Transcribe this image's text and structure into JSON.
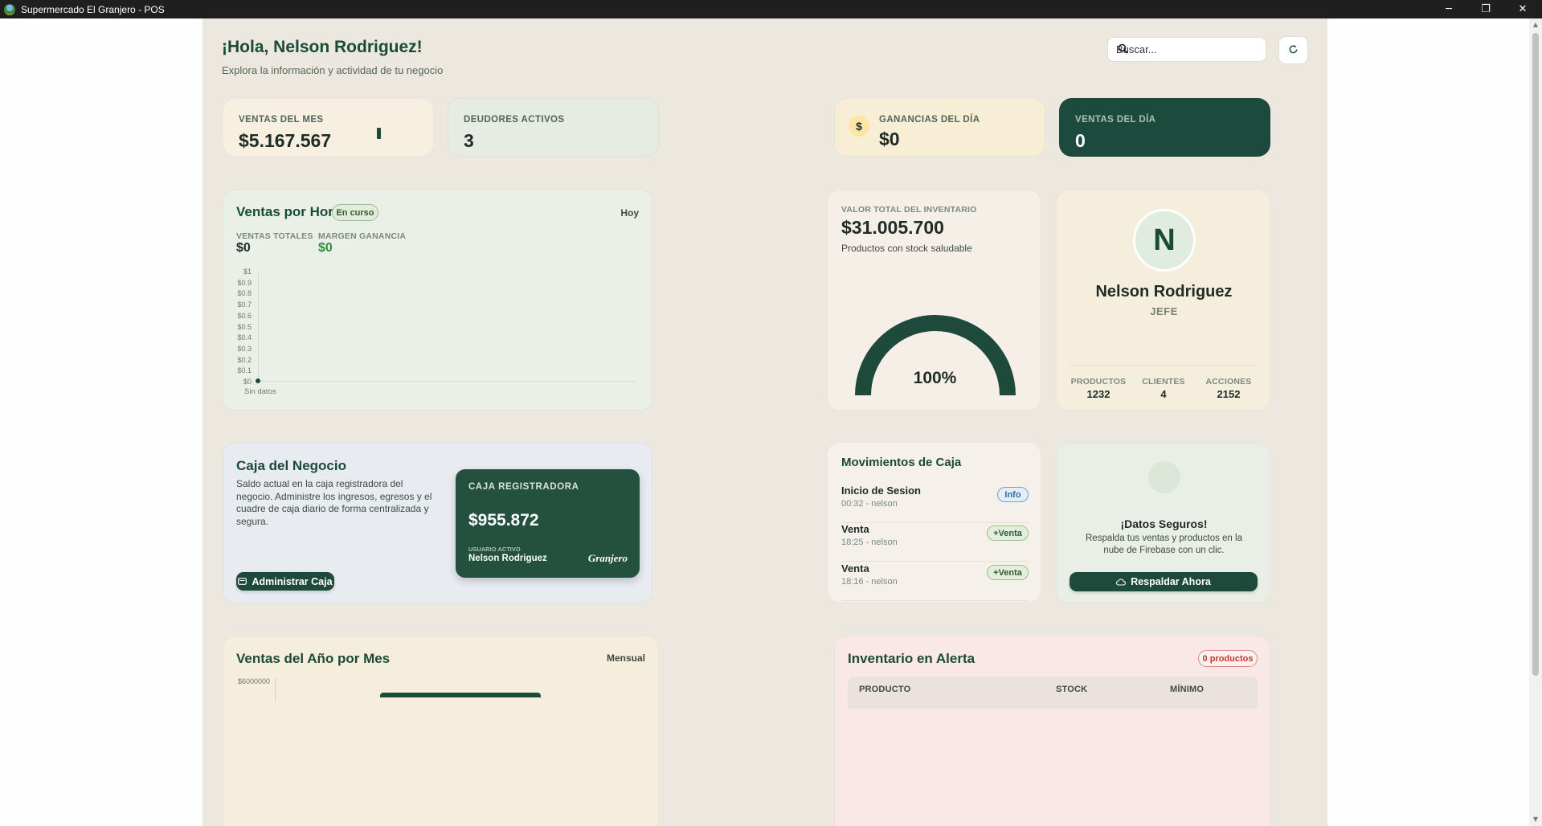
{
  "window": {
    "title": "Supermercado El Granjero - POS",
    "minimize": "─",
    "maximize": "❐",
    "close": "✕"
  },
  "header": {
    "greeting": "¡Hola, Nelson Rodriguez!",
    "subtitle": "Explora la información y actividad de tu negocio",
    "search_placeholder": "Buscar..."
  },
  "stats": [
    {
      "label": "VENTAS DEL MES",
      "value": "$5.167.567"
    },
    {
      "label": "DEUDORES ACTIVOS",
      "value": "3"
    },
    {
      "label": "GANANCIAS DEL DÍA",
      "value": "$0",
      "icon": "$"
    },
    {
      "label": "VENTAS DEL DÍA",
      "value": "0"
    }
  ],
  "hourly": {
    "title": "Ventas por Hora",
    "badge": "En curso",
    "period": "Hoy",
    "total_label": "VENTAS TOTALES",
    "total_value": "$0",
    "margin_label": "MARGEN GANANCIA",
    "margin_value": "$0",
    "empty_text": "Sin datos"
  },
  "chart_data": {
    "type": "line",
    "title": "Ventas por Hora",
    "y_ticks": [
      "$1",
      "$0.9",
      "$0.8",
      "$0.7",
      "$0.6",
      "$0.5",
      "$0.4",
      "$0.3",
      "$0.2",
      "$0.1",
      "$0"
    ],
    "ylim": [
      0,
      1
    ],
    "x": [],
    "series": [
      {
        "values": [
          0
        ]
      }
    ],
    "annotation": "Sin datos"
  },
  "inventory": {
    "label": "VALOR TOTAL DEL INVENTARIO",
    "value": "$31.005.700",
    "status": "Productos con stock saludable",
    "gauge_percent": 100,
    "gauge_text": "100%",
    "color": "#1e4a3c"
  },
  "profile": {
    "initial": "N",
    "name": "Nelson Rodriguez",
    "role": "JEFE",
    "stats": [
      {
        "label": "PRODUCTOS",
        "value": "1232"
      },
      {
        "label": "CLIENTES",
        "value": "4"
      },
      {
        "label": "ACCIONES",
        "value": "2152"
      }
    ]
  },
  "caja": {
    "title": "Caja del Negocio",
    "description": "Saldo actual en la caja registradora del negocio. Administre los ingresos, egresos y el cuadre de caja diario de forma centralizada y segura.",
    "button": "Administrar Caja",
    "card_label": "CAJA REGISTRADORA",
    "card_amount": "$955.872",
    "user_label": "USUARIO ACTIVO",
    "user_name": "Nelson Rodriguez",
    "brand": "Granjero"
  },
  "movements": {
    "title": "Movimientos de Caja",
    "items": [
      {
        "title": "Inicio de Sesion",
        "sub": "00:32 - nelson",
        "badge": "Info"
      },
      {
        "title": "Venta",
        "sub": "18:25 - nelson",
        "badge": "+Venta"
      },
      {
        "title": "Venta",
        "sub": "18:16 - nelson",
        "badge": "+Venta"
      }
    ]
  },
  "backup": {
    "title": "¡Datos Seguros!",
    "description": "Respalda tus ventas y productos en la nube de Firebase con un clic.",
    "button": "Respaldar Ahora"
  },
  "yearly": {
    "title": "Ventas del Año por Mes",
    "period": "Mensual",
    "first_tick": "$6000000"
  },
  "alerts": {
    "title": "Inventario en Alerta",
    "badge": "0 productos",
    "columns": [
      "PRODUCTO",
      "STOCK",
      "MÍNIMO"
    ]
  }
}
